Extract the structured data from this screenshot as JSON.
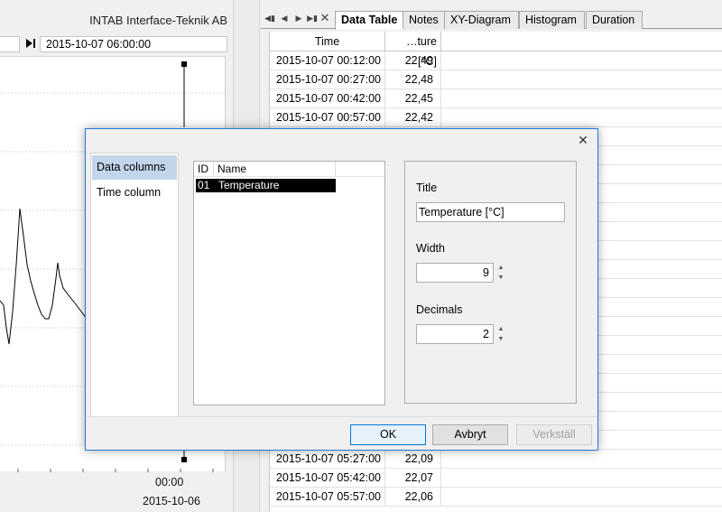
{
  "chart_panel": {
    "company": "INTAB Interface-Teknik AB",
    "nav_date": "2015-10-07 06:00:00",
    "axis_time": "00:00",
    "axis_date": "2015-10-06",
    "line_color": "#000000",
    "marker_color": "#000000"
  },
  "tabs": [
    {
      "label": "Data Table",
      "active": true
    },
    {
      "label": "Notes",
      "active": false
    },
    {
      "label": "XY-Diagram",
      "active": false
    },
    {
      "label": "Histogram",
      "active": false
    },
    {
      "label": "Duration",
      "active": false
    }
  ],
  "table": {
    "columns": [
      "Time",
      "…ture [°C]"
    ],
    "rows_top": [
      {
        "time": "2015-10-07 00:12:00",
        "temp": "22,49"
      },
      {
        "time": "2015-10-07 00:27:00",
        "temp": "22,48"
      },
      {
        "time": "2015-10-07 00:42:00",
        "temp": "22,45"
      },
      {
        "time": "2015-10-07 00:57:00",
        "temp": "22,42"
      }
    ],
    "rows_bottom": [
      {
        "time": "2015-10-07 05:27:00",
        "temp": "22,09"
      },
      {
        "time": "2015-10-07 05:42:00",
        "temp": "22,07"
      },
      {
        "time": "2015-10-07 05:57:00",
        "temp": "22,06"
      }
    ]
  },
  "dialog": {
    "nav": [
      "Data columns",
      "Time column"
    ],
    "selected_nav": "Data columns",
    "list_headers": {
      "id": "ID",
      "name": "Name"
    },
    "list_rows": [
      {
        "id": "01",
        "name": "Temperature"
      }
    ],
    "title_label": "Title",
    "title_value": "Temperature [°C]",
    "width_label": "Width",
    "width_value": "9",
    "decimals_label": "Decimals",
    "decimals_value": "2",
    "ok": "OK",
    "cancel": "Avbryt",
    "apply": "Verkställ",
    "accent_color": "#2b79d4"
  }
}
